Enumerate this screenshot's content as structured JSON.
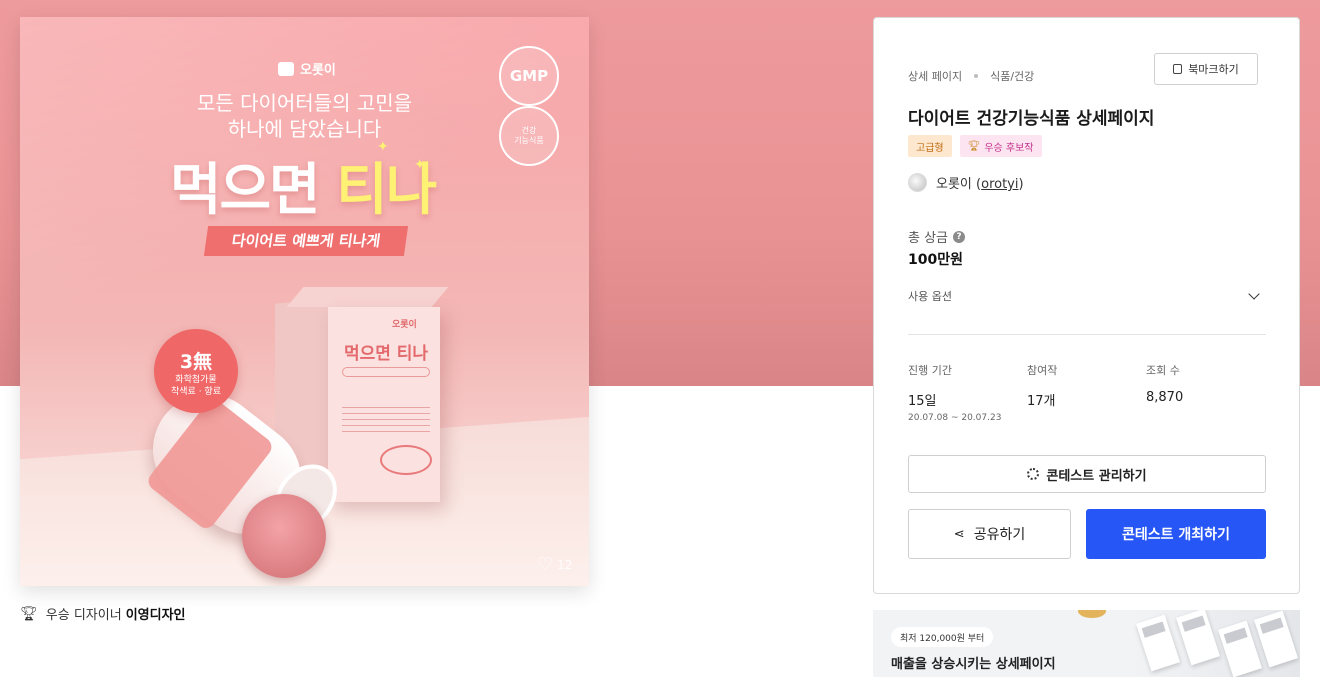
{
  "product": {
    "brand": "오롯이",
    "headline_line1": "모든 다이어터들의 고민을",
    "headline_line2": "하나에 담았습니다",
    "title_main": "먹으면 ",
    "title_accent": "티나",
    "ribbon": "다이어트 예쁘게 티나게",
    "gmp_badge": "GMP",
    "health_badge_line1": "건강",
    "health_badge_line2": "기능식품",
    "free_badge_title": "3無",
    "free_badge_line1": "화학첨가물",
    "free_badge_line2": "착색료 · 향료",
    "box_brand": "오롯이",
    "box_title": "먹으면 티나",
    "box_gmp": "GMP",
    "likes": "12"
  },
  "winner": {
    "label": "우승 디자이너",
    "name": "이영디자인"
  },
  "panel": {
    "breadcrumb": [
      "상세 페이지",
      "식품/건강"
    ],
    "bookmark_label": "북마크하기",
    "title": "다이어트 건강기능식품 상세페이지",
    "tags": [
      {
        "label": "고급형"
      },
      {
        "label": "우승 후보작"
      }
    ],
    "designer_name": "오롯이",
    "designer_handle": "orotyi",
    "prize_label": "총 상금",
    "prize_value": "100만원",
    "usage_label": "사용 옵션",
    "stats": {
      "period_label": "진행 기간",
      "period_value": "15일",
      "period_dates": "20.07.08 ~ 20.07.23",
      "entries_label": "참여작",
      "entries_value": "17개",
      "views_label": "조회 수",
      "views_value": "8,870"
    },
    "manage_label": "콘테스트 관리하기",
    "share_label": "공유하기",
    "host_label": "콘테스트 개최하기"
  },
  "banner": {
    "pill": "최저 120,000원 부터",
    "text": "매출을 상승시키는 상세페이지"
  },
  "colors": {
    "hero_bg": "#ee9b9d",
    "primary_button": "#2656f5",
    "tag_premium_bg": "#fde8cf",
    "tag_candidate_bg": "#fde4f1"
  },
  "icons": {
    "bookmark": "bookmark-icon",
    "trophy": "trophy-icon",
    "help": "help-icon",
    "chevron": "chevron-down-icon",
    "gear": "gear-icon",
    "share": "share-icon",
    "heart": "heart-icon"
  }
}
